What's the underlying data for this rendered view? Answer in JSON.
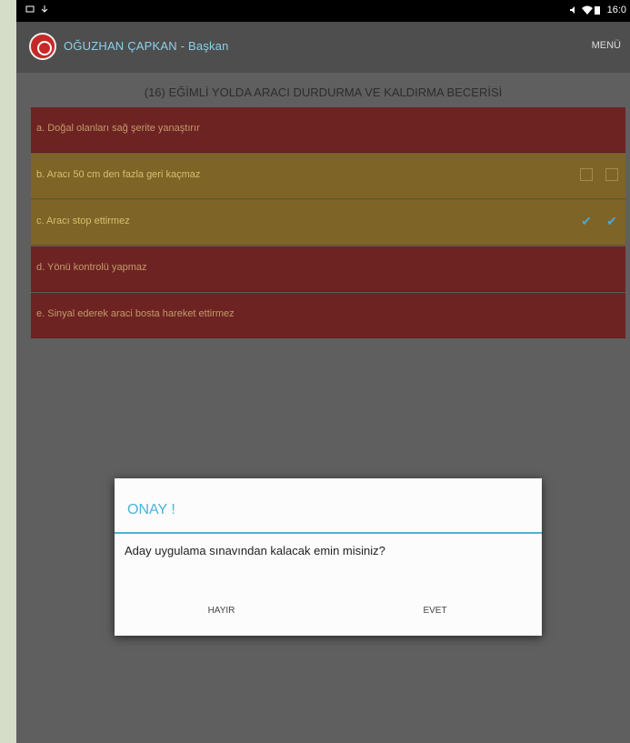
{
  "status_bar": {
    "time": "16:0"
  },
  "app_bar": {
    "title": "OĞUZHAN ÇAPKAN - Başkan",
    "menu_label": "MENÜ"
  },
  "section_title": "(16) EĞİMLİ YOLDA ARACI DURDURMA VE KALDIRMA BECERİSİ",
  "rows": [
    {
      "label": "a. Doğal olanları sağ şerite yanaştırır",
      "state": "fail"
    },
    {
      "label": "b. Aracı 50 cm den fazla geri kaçmaz",
      "state": "warn"
    },
    {
      "label": "c. Aracı stop ettirmez",
      "state": "warn"
    },
    {
      "label": "d. Yönü kontrolü yapmaz",
      "state": "fail"
    },
    {
      "label": "e. Sinyal ederek araci bosta hareket ettirmez",
      "state": "fail"
    }
  ],
  "dialog": {
    "title": "ONAY !",
    "message": "Aday uygulama sınavından kalacak emin misiniz?",
    "no_label": "HAYIR",
    "yes_label": "EVET"
  },
  "colors": {
    "accent": "#49b4da",
    "fail_row": "#6e2323",
    "warn_row": "#7e6426"
  }
}
